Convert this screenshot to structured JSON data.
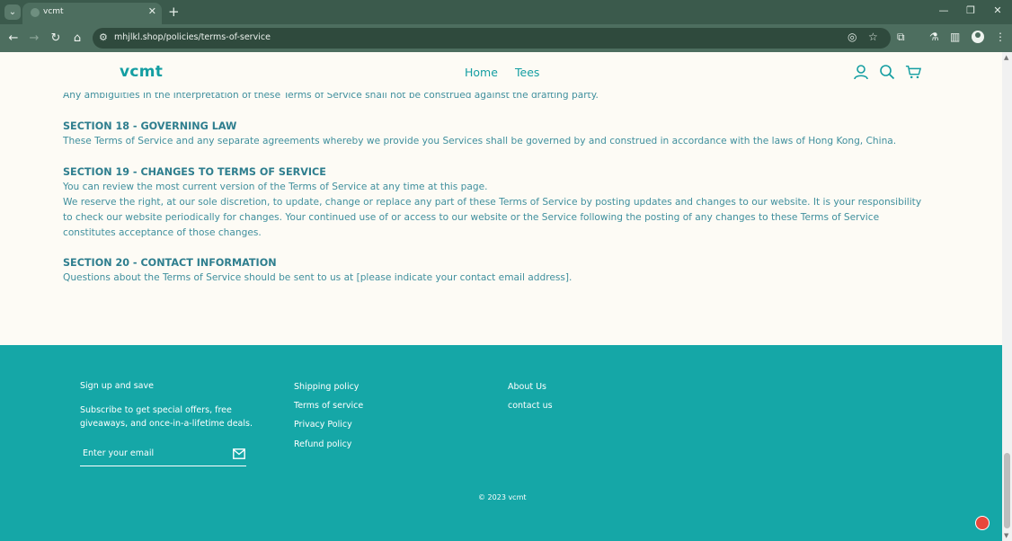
{
  "browser": {
    "tab_title": "vcmt",
    "url": "mhjlkl.shop/policies/terms-of-service",
    "icons": [
      "tab-list-icon",
      "close-icon",
      "plus-icon",
      "minimize-icon",
      "restore-icon",
      "close-window-icon",
      "back-icon",
      "forward-icon",
      "reload-icon",
      "home-icon",
      "site-info-icon",
      "eye-off-icon",
      "star-icon",
      "extensions-icon",
      "labs-icon",
      "sidebar-icon",
      "profile-icon",
      "more-icon"
    ],
    "glyphs": {
      "tab_list": "⌄",
      "tab_close": "✕",
      "new_tab": "+",
      "minimize": "—",
      "restore": "❐",
      "close_window": "✕",
      "back": "←",
      "forward": "→",
      "reload": "↻",
      "home": "⌂",
      "site_info": "⚙",
      "eye_off": "◎",
      "star": "☆",
      "extensions": "⧉",
      "labs": "⚗",
      "sidebar": "▥",
      "more": "⋮"
    }
  },
  "header": {
    "logo": "vcmt",
    "menu": [
      {
        "label": "Home"
      },
      {
        "label": "Tees"
      }
    ],
    "icons": [
      "account-icon",
      "search-icon",
      "cart-icon"
    ]
  },
  "policy": {
    "cut_line": "Any ambiguities in the interpretation of these Terms of Service shall not be construed against the drafting party.",
    "sections": [
      {
        "heading": "SECTION 18 - GOVERNING LAW",
        "paragraphs": [
          "These Terms of Service and any separate agreements whereby we provide you Services shall be governed by and construed in accordance with the laws of Hong Kong, China."
        ]
      },
      {
        "heading": "SECTION 19 - CHANGES TO TERMS OF SERVICE",
        "paragraphs": [
          "You can review the most current version of the Terms of Service at any time at this page.",
          "We reserve the right, at our sole discretion, to update, change or replace any part of these Terms of Service by posting updates and changes to our website. It is your responsibility to check our website periodically for changes. Your continued use of or access to our website or the Service following the posting of any changes to these Terms of Service constitutes acceptance of those changes."
        ]
      },
      {
        "heading": "SECTION 20 - CONTACT INFORMATION",
        "paragraphs": [
          "Questions about the Terms of Service should be sent to us at [please indicate your contact email address]."
        ]
      }
    ]
  },
  "footer": {
    "newsletter": {
      "heading": "Sign up and save",
      "description_line1": "Subscribe to get special offers, free",
      "description_line2": "giveaways, and once-in-a-lifetime deals.",
      "email_placeholder": "Enter your email"
    },
    "links_col1": [
      {
        "label": "Shipping policy"
      },
      {
        "label": "Terms of service"
      },
      {
        "label": "Privacy Policy"
      },
      {
        "label": "Refund policy"
      }
    ],
    "links_col2": [
      {
        "label": "About Us"
      },
      {
        "label": "contact us"
      }
    ],
    "copyright": "© 2023 vcmt",
    "icons": [
      "mail-icon",
      "chat-icon"
    ]
  },
  "colors": {
    "accent": "#149ea2",
    "footer_bg": "#15a7a7",
    "page_bg": "#fdfbf5",
    "body_text": "#3f8f9d",
    "chrome": "#4d6e5f"
  }
}
